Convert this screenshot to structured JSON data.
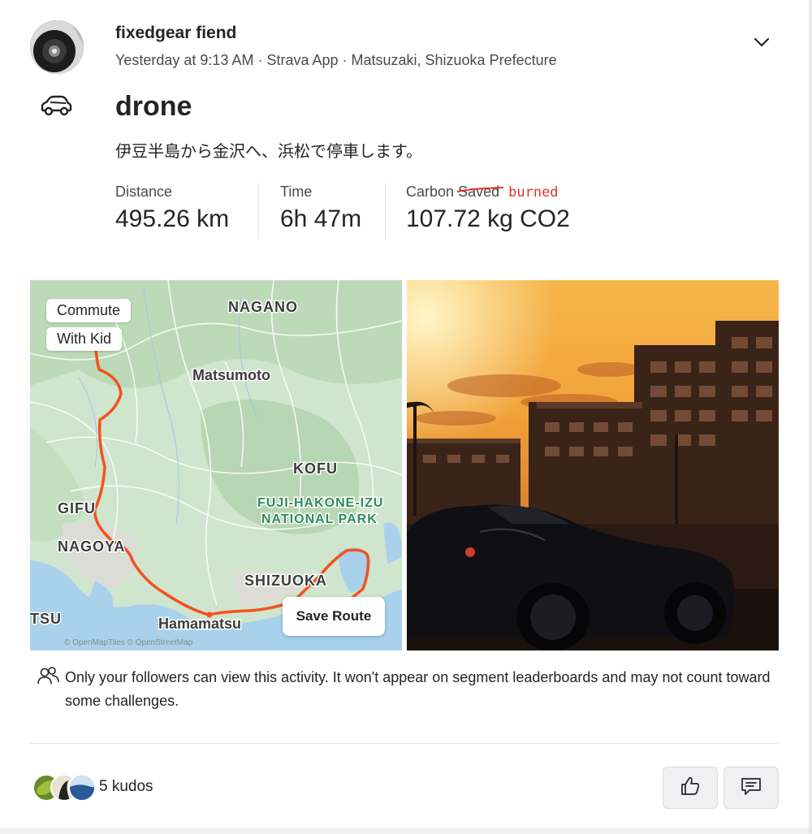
{
  "athlete": {
    "name": "fixedgear fiend",
    "meta": "Yesterday at 9:13 AM · Strava App · Matsuzaki, Shizuoka Prefecture"
  },
  "activity": {
    "sport_icon": "car-icon",
    "title": "drone",
    "description": "伊豆半島から金沢へ、浜松で停車します。"
  },
  "stats": [
    {
      "label": "Distance",
      "value": "495.26 km"
    },
    {
      "label": "Time",
      "value": "6h 47m"
    },
    {
      "label_prefix": "Carbon",
      "label_struck": "Saved",
      "label_annotation": "burned",
      "value": "107.72 kg CO2"
    }
  ],
  "map": {
    "tags": [
      "Commute",
      "With Kid"
    ],
    "place_labels": [
      "NAGANO",
      "Matsumoto",
      "KOFU",
      "FUJI-HAKONE-IZU",
      "NATIONAL PARK",
      "GIFU",
      "NAGOYA",
      "SHIZUOKA",
      "Hamamatsu",
      "TSU"
    ],
    "attribution": "© OpenMapTiles © OpenStreetMap",
    "save_route_label": "Save Route",
    "route_color": "#f4511e"
  },
  "privacy": {
    "icon": "people-icon",
    "text": "Only your followers can view this activity. It won't appear on segment leaderboards and may not count toward some challenges."
  },
  "kudos": {
    "count_label": "5 kudos"
  },
  "actions": {
    "kudo_icon": "thumbs-up-icon",
    "comment_icon": "comment-icon"
  },
  "colors": {
    "text": "#242428",
    "annotation": "#e0332a",
    "route": "#f4511e"
  }
}
